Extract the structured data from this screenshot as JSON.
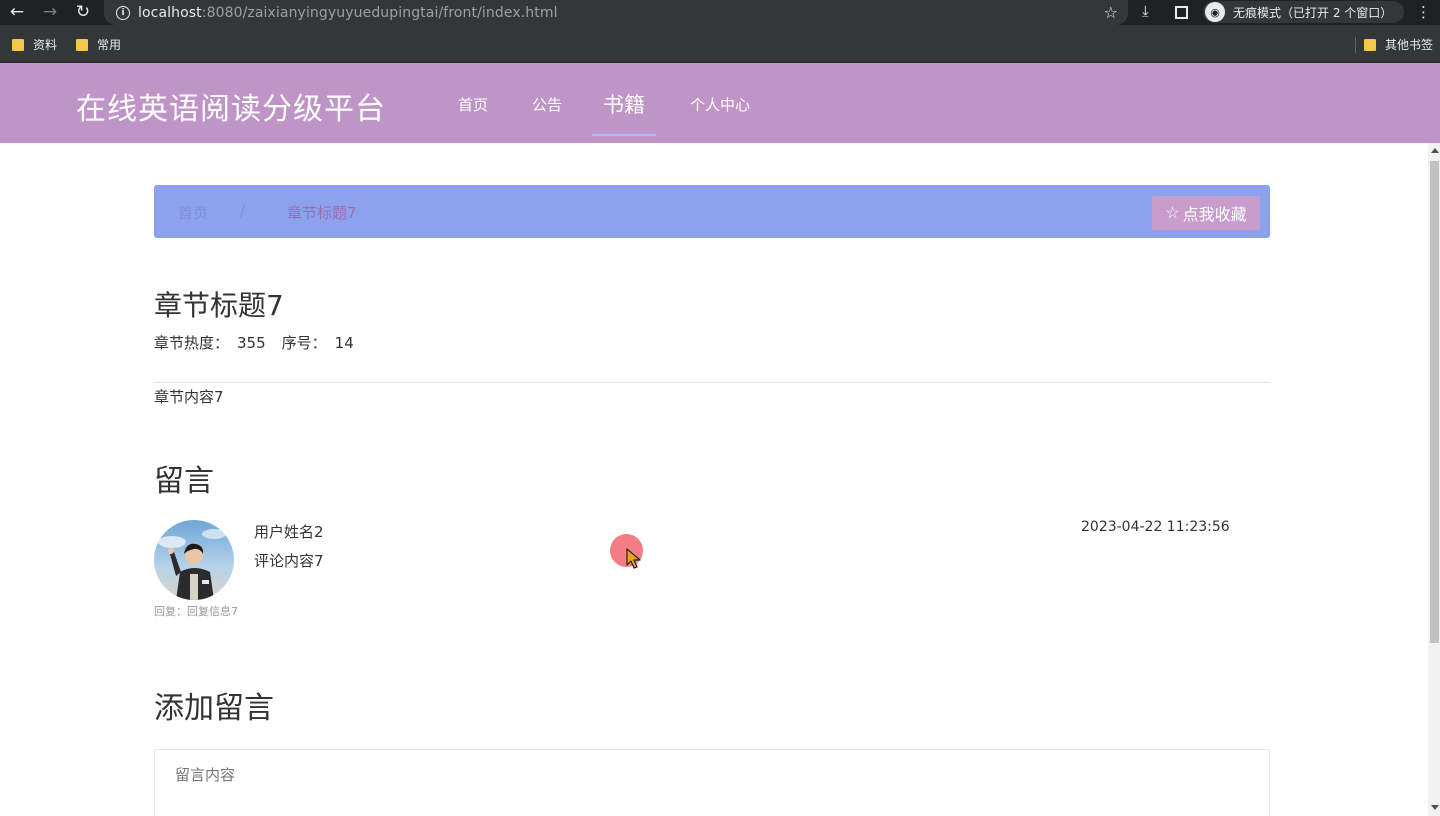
{
  "browser": {
    "url_host": "localhost",
    "url_rest": ":8080/zaixianyingyuyuedupingtai/front/index.html",
    "incognito_label": "无痕模式（已打开 2 个窗口）",
    "bookmarks": [
      {
        "label": "资料"
      },
      {
        "label": "常用"
      }
    ],
    "other_bookmarks": "其他书签"
  },
  "site": {
    "title": "在线英语阅读分级平台",
    "nav": [
      {
        "label": "首页"
      },
      {
        "label": "公告"
      },
      {
        "label": "书籍"
      },
      {
        "label": "个人中心"
      }
    ]
  },
  "breadcrumb": {
    "home": "首页",
    "separator": "/",
    "current": "章节标题7",
    "favorite_label": "点我收藏"
  },
  "chapter": {
    "title": "章节标题7",
    "heat_label": "章节热度：",
    "heat_value": "355",
    "seq_label": "序号：",
    "seq_value": "14",
    "content": "章节内容7"
  },
  "comments": {
    "section_title": "留言",
    "items": [
      {
        "user": "用户姓名2",
        "text": "评论内容7",
        "time": "2023-04-22 11:23:56",
        "reply": "回复：回复信息7"
      }
    ]
  },
  "add_comment": {
    "section_title": "添加留言",
    "placeholder": "留言内容"
  },
  "colors": {
    "header_bg": "#bf95c7",
    "breadcrumb_bg": "#8da2ee",
    "favorite_btn_bg": "#c89dce"
  }
}
